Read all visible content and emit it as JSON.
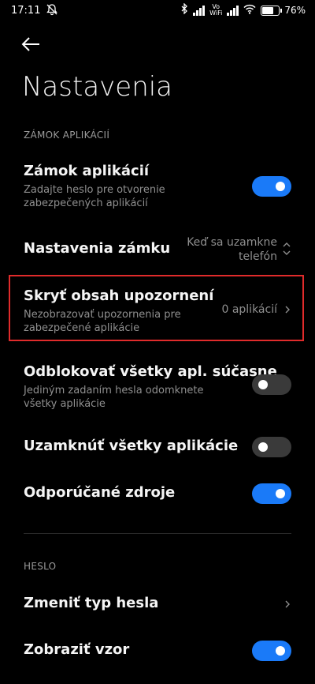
{
  "status_bar": {
    "time": "17:11",
    "battery_pct": "76",
    "battery_level": 0.76,
    "vowifi_top": "Vo",
    "vowifi_bottom": "WiFi"
  },
  "header": {
    "title": "Nastavenia"
  },
  "sections": {
    "app_lock": {
      "label": "ZÁMOK APLIKÁCIÍ"
    },
    "password": {
      "label": "HESLO"
    }
  },
  "rows": {
    "app_lock": {
      "title": "Zámok aplikácií",
      "subtitle": "Zadajte heslo pre otvorenie zabezpečených aplikácií",
      "toggle": "on"
    },
    "lock_settings": {
      "title": "Nastavenia zámku",
      "value_line1": "Keď sa uzamkne",
      "value_line2": "telefón"
    },
    "hide_notifications": {
      "title": "Skryť obsah upozornení",
      "subtitle": "Nezobrazovať upozornenia pre zabezpečené aplikácie",
      "value": "0 aplikácií"
    },
    "unlock_all": {
      "title": "Odblokovať všetky apl. súčasne",
      "subtitle": "Jediným zadaním hesla odomknete všetky aplikácie",
      "toggle": "off"
    },
    "lock_all": {
      "title": "Uzamknúť všetky aplikácie",
      "toggle": "off"
    },
    "recommended": {
      "title": "Odporúčané zdroje",
      "toggle": "on"
    },
    "change_password_type": {
      "title": "Zmeniť typ hesla"
    },
    "show_pattern": {
      "title": "Zobraziť vzor",
      "toggle": "on"
    }
  },
  "colors": {
    "accent": "#1a7af8",
    "highlight": "#e02b2b",
    "background": "#000000"
  }
}
